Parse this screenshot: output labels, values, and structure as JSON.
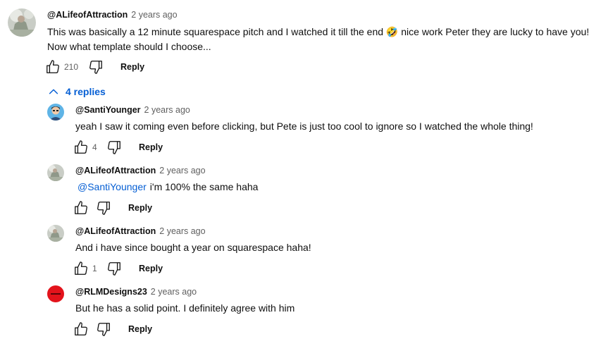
{
  "top_comment": {
    "author": "@ALifeofAttraction",
    "time": "2 years ago",
    "text_line1": "This was basically a 12 minute squarespace pitch and I watched it till the end 🤣 nice work Peter they are lucky to have you!",
    "text_line2": "Now what template should I choose...",
    "likes": "210",
    "reply_label": "Reply",
    "avatar_icon": "profile-photo-icon"
  },
  "replies_toggle": {
    "label": "4 replies",
    "icon": "chevron-up-icon"
  },
  "replies": [
    {
      "author": "@SantiYounger",
      "time": "2 years ago",
      "text": "yeah I saw it coming even before clicking, but Pete is just too cool to ignore so I watched the whole thing!",
      "likes": "4",
      "reply_label": "Reply"
    },
    {
      "author": "@ALifeofAttraction",
      "time": "2 years ago",
      "mention": "@SantiYounger",
      "text": "i'm 100% the same haha",
      "likes": "",
      "reply_label": "Reply"
    },
    {
      "author": "@ALifeofAttraction",
      "time": "2 years ago",
      "text": "And i have since bought a year on squarespace haha!",
      "likes": "1",
      "reply_label": "Reply"
    },
    {
      "author": "@RLMDesigns23",
      "time": "2 years ago",
      "text": "But he has a solid point. I definitely agree with him",
      "likes": "",
      "reply_label": "Reply"
    }
  ],
  "colors": {
    "link_blue": "#065fd4",
    "secondary_text": "#606060",
    "primary_text": "#0f0f0f",
    "rlm_avatar_red": "#e3131b"
  }
}
